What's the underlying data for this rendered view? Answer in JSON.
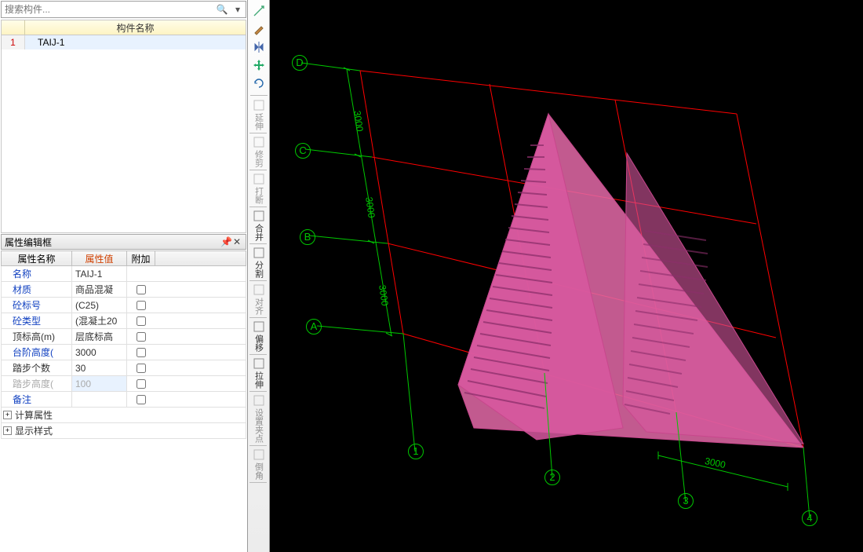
{
  "search": {
    "placeholder": "搜索构件..."
  },
  "componentList": {
    "header": "构件名称",
    "rows": [
      {
        "num": "1",
        "name": "TAIJ-1"
      }
    ]
  },
  "propPanel": {
    "title": "属性编辑框",
    "headers": {
      "c1": "属性名称",
      "c2": "属性值",
      "c3": "附加"
    },
    "rows": [
      {
        "name": "名称",
        "value": "TAIJ-1",
        "blue": true,
        "cb": false
      },
      {
        "name": "材质",
        "value": "商品混凝",
        "blue": true,
        "cb": true
      },
      {
        "name": "砼标号",
        "value": "(C25)",
        "blue": true,
        "cb": true
      },
      {
        "name": "砼类型",
        "value": "(混凝土20",
        "blue": true,
        "cb": true
      },
      {
        "name": "顶标高(m)",
        "value": "层底标高",
        "blue": false,
        "cb": true
      },
      {
        "name": "台阶高度(",
        "value": "3000",
        "blue": true,
        "cb": true
      },
      {
        "name": "踏步个数",
        "value": "30",
        "blue": false,
        "cb": true
      },
      {
        "name": "踏步高度(",
        "value": "100",
        "blue": false,
        "cb": true,
        "gray": true,
        "sel": true
      },
      {
        "name": "备注",
        "value": "",
        "blue": true,
        "cb": true
      }
    ],
    "trees": [
      "计算属性",
      "显示样式"
    ]
  },
  "toolbar": {
    "items": [
      {
        "name": "pan",
        "icon": "pan"
      },
      {
        "name": "brush",
        "icon": "brush"
      },
      {
        "name": "mirror",
        "icon": "mirror"
      },
      {
        "name": "move-arrows",
        "icon": "move"
      },
      {
        "name": "rotate",
        "icon": "rotate"
      }
    ],
    "labeled": [
      {
        "name": "extend",
        "label": "延伸",
        "dim": true
      },
      {
        "name": "trim",
        "label": "修剪",
        "dim": true
      },
      {
        "name": "break",
        "label": "打断",
        "dim": true
      },
      {
        "name": "merge",
        "label": "合并",
        "dim": false
      },
      {
        "name": "split",
        "label": "分割",
        "dim": false
      },
      {
        "name": "align",
        "label": "对齐",
        "dim": true
      },
      {
        "name": "offset",
        "label": "偏移",
        "dim": false
      },
      {
        "name": "stretch",
        "label": "拉伸",
        "dim": false
      },
      {
        "name": "set-grip",
        "label": "设置夹点",
        "dim": true
      },
      {
        "name": "chamfer",
        "label": "倒角",
        "dim": true
      }
    ]
  },
  "grid": {
    "rowLabels": [
      "A",
      "B",
      "C",
      "D"
    ],
    "colLabels": [
      "1",
      "2",
      "3",
      "4"
    ],
    "dimH": "3000",
    "dimV": [
      "3000",
      "3000",
      "3000"
    ]
  }
}
